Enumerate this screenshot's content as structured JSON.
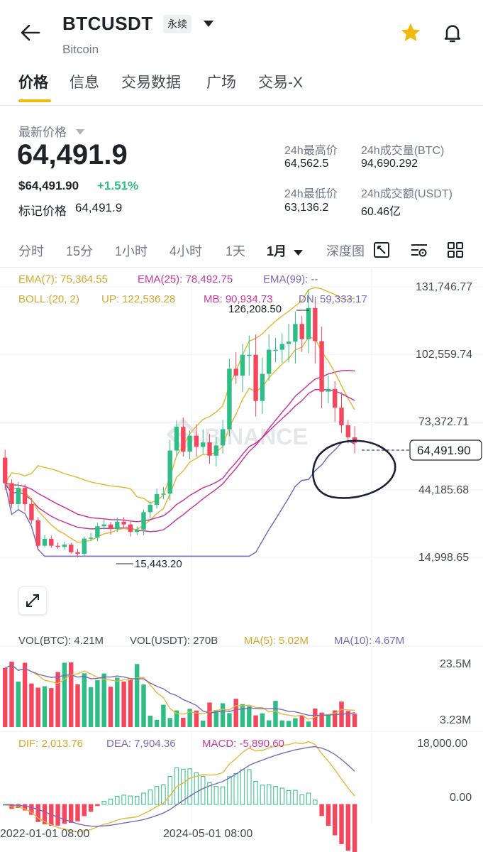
{
  "header": {
    "symbol": "BTCUSDT",
    "contract_badge": "永续",
    "subtitle": "Bitcoin"
  },
  "tabs": [
    "价格",
    "信息",
    "交易数据",
    "广场",
    "交易-X"
  ],
  "price": {
    "latest_label": "最新价格",
    "last_price": "64,491.9",
    "usd_price": "$64,491.90",
    "change_pct": "+1.51%",
    "mark_label": "标记价格",
    "mark_price": "64,491.9"
  },
  "stats": {
    "high_label": "24h最高价",
    "high_value": "64,562.5",
    "low_label": "24h最低价",
    "low_value": "63,136.2",
    "vol_btc_label": "24h成交量(BTC)",
    "vol_btc_value": "94,690.292",
    "vol_usdt_label": "24h成交额(USDT)",
    "vol_usdt_value": "60.46亿"
  },
  "timeframes": [
    "分时",
    "15分",
    "1小时",
    "4小时",
    "1天",
    "1月",
    "深度图"
  ],
  "selected_timeframe": "1月",
  "indicators": {
    "ema7": "EMA(7): 75,364.55",
    "ema25": "EMA(25): 78,492.75",
    "ema99": "EMA(99): --",
    "boll": "BOLL:(20, 2)",
    "boll_up": "UP: 122,536.28",
    "boll_mb": "MB: 90,934.73",
    "boll_dn": "DN: 59,333.17",
    "vol_btc": "VOL(BTC): 4.21M",
    "vol_usdt": "VOL(USDT): 270B",
    "ma5": "MA(5): 5.02M",
    "ma10": "MA(10): 4.67M",
    "dif": "DIF: 2,013.76",
    "dea": "DEA: 7,904.36",
    "macd": "MACD: -5,890.60"
  },
  "price_axis": [
    "131,746.77",
    "102,559.74",
    "73,372.71",
    "44,185.68",
    "14,998.65"
  ],
  "current_price_tag": "64,491.90",
  "high_marker": "126,208.50",
  "low_marker": "15,443.20",
  "volume_axis": [
    "23.5M",
    "3.23M"
  ],
  "macd_axis": [
    "18,000.00",
    "0.00"
  ],
  "time_axis": [
    "2022-01-01 08:00",
    "2024-05-01 08:00"
  ],
  "watermark": "BINANCE",
  "colors": {
    "accent": "#f0b90b",
    "up": "#2ebd85",
    "down": "#f6465d",
    "ema7": "#e2b93b",
    "ema25": "#c53aa0",
    "ema99": "#7b6ab8",
    "boll_up": "#e2b93b",
    "boll_mb": "#c53aa0",
    "boll_dn": "#7b6ab8"
  },
  "chart_data": {
    "type": "candlestick",
    "interval": "1 month",
    "closes": [
      47000,
      38000,
      45000,
      38000,
      31000,
      20000,
      23000,
      20000,
      19500,
      20500,
      17200,
      16500,
      23100,
      23500,
      28400,
      29200,
      27200,
      30400,
      29200,
      26000,
      27000,
      34500,
      37700,
      42300,
      42500,
      61100,
      71300,
      60600,
      67500,
      62700,
      64600,
      58900,
      63300,
      70300,
      96400,
      93400,
      102400,
      102400,
      82500,
      94200,
      104600,
      104600,
      107100,
      108100,
      115700,
      109200,
      122600,
      108300,
      86500,
      87700,
      79600,
      72000,
      66800,
      64491.9
    ],
    "ylim": [
      14998.65,
      131746.77
    ],
    "y_ticks": [
      131746.77,
      102559.74,
      73372.71,
      44185.68,
      14998.65
    ],
    "marked_high": 126208.5,
    "marked_low": 15443.2,
    "current": 64491.9
  }
}
